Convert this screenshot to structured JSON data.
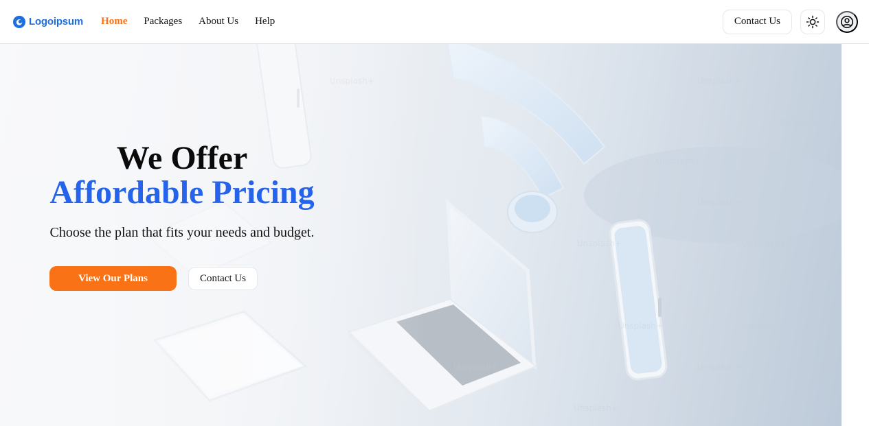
{
  "brand": {
    "name": "Logoipsum",
    "logo_icon": "logoipsum-mark-icon",
    "color": "#1d6fe0"
  },
  "nav": {
    "links": [
      {
        "label": "Home",
        "active": true
      },
      {
        "label": "Packages",
        "active": false
      },
      {
        "label": "About Us",
        "active": false
      },
      {
        "label": "Help",
        "active": false
      }
    ],
    "contact_label": "Contact Us",
    "theme_icon": "sun-icon",
    "profile_icon": "user-circle-icon"
  },
  "hero": {
    "title_line1": "We Offer",
    "title_line2": "Affordable Pricing",
    "subtitle": "Choose the plan that fits your needs and budget.",
    "primary_cta": "View Our Plans",
    "secondary_cta": "Contact Us",
    "background_description_icons": [
      "wifi-icon",
      "laptop-icon",
      "phone-icon",
      "tablet-icon"
    ]
  },
  "colors": {
    "accent": "#f97316",
    "headline_blue": "#2563eb",
    "text": "#111111"
  }
}
